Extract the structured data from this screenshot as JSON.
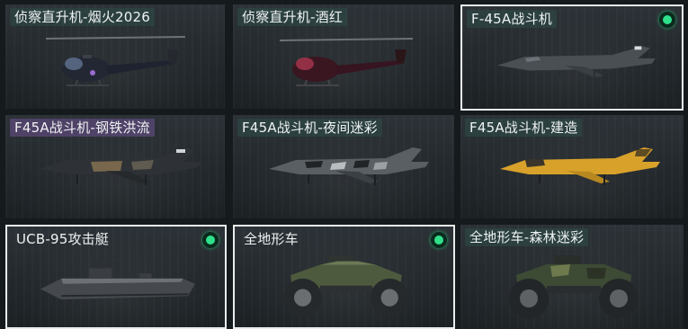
{
  "cards": [
    {
      "title": "侦察直升机-烟火2026"
    },
    {
      "title": "侦察直升机-酒红"
    },
    {
      "title": "F-45A战斗机"
    },
    {
      "title": "F45A战斗机-钢铁洪流"
    },
    {
      "title": "F45A战斗机-夜间迷彩"
    },
    {
      "title": "F45A战斗机-建造"
    },
    {
      "title": "UCB-95攻击艇"
    },
    {
      "title": "全地形车"
    },
    {
      "title": "全地形车-森林迷彩"
    }
  ],
  "colors": {
    "equipped": "#2fe08a",
    "selected_border": "#e9ecec",
    "title_bg": "#2e4c48",
    "title_bg_alt": "#5c4878"
  }
}
